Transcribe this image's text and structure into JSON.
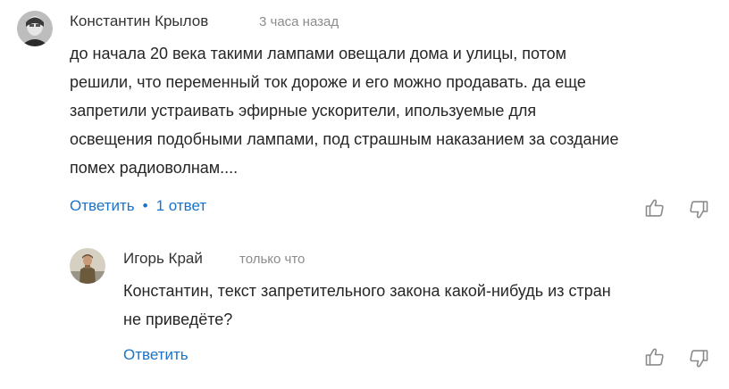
{
  "comment": {
    "author": "Константин Крылов",
    "time": "3 часа назад",
    "text_lines": [
      "до начала 20 века такими лампами овещали дома и улицы, потом",
      "решили, что переменный ток дороже и его можно продавать. да еще",
      "запретили устраивать эфирные ускорители, ипользуемые для",
      "освещения подобными лампами, под страшным наказанием за создание",
      "помех радиоволнам...."
    ],
    "reply_label": "Ответить",
    "separator": "•",
    "replies_count_label": "1 ответ",
    "like_icon": "thumbs-up-icon",
    "dislike_icon": "thumbs-down-icon"
  },
  "reply": {
    "author": "Игорь Край",
    "time": "только что",
    "text_lines": [
      "Константин, текст запретительного закона какой-нибудь из стран",
      "не приведёте?"
    ],
    "reply_label": "Ответить",
    "like_icon": "thumbs-up-icon",
    "dislike_icon": "thumbs-down-icon"
  },
  "colors": {
    "link": "#1a73c8",
    "meta": "#8c8c8c",
    "text": "#262626"
  }
}
